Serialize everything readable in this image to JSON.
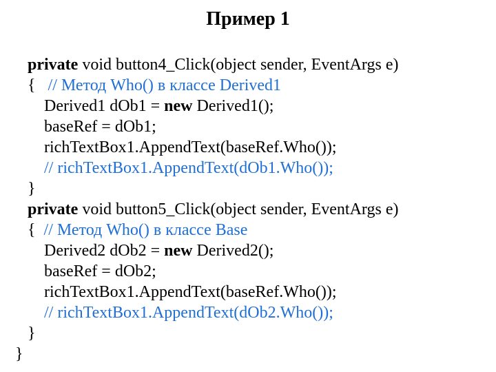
{
  "title": "Пример 1",
  "sig1_kw": "private",
  "sig1_rest": " void button4_Click(object sender, EventArgs e)",
  "brace_open": "{   ",
  "cmt1": "// Метод Who() в классе Derived1",
  "l1a": "    Derived1 dOb1 = ",
  "l1b_kw": "new",
  "l1b": " Derived1();",
  "l2": "    baseRef = dOb1;",
  "l3": "    richTextBox1.AppendText(baseRef.Who());",
  "l4_pre": "    ",
  "cmt2": "// richTextBox1.AppendText(dOb1.Who());",
  "brace_close": "}",
  "sig2_kw": "private",
  "sig2_rest": " void button5_Click(object sender, EventArgs e)",
  "brace_open2": "{  ",
  "cmt3": "// Метод Who() в классе Base",
  "m1a": "    Derived2 dOb2 = ",
  "m1b_kw": "new",
  "m1b": " Derived2();",
  "m2": "    baseRef = dOb2;",
  "m3": "    richTextBox1.AppendText(baseRef.Who());",
  "m4_pre": "    ",
  "cmt4": "// richTextBox1.AppendText(dOb2.Who());",
  "final_close": "}"
}
